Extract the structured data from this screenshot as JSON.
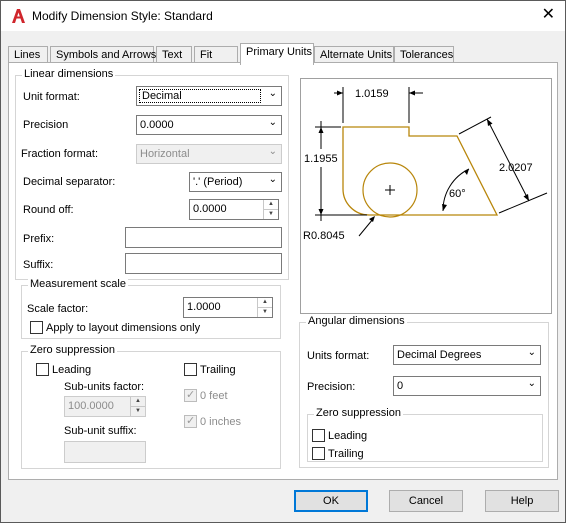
{
  "window": {
    "title": "Modify Dimension Style: Standard",
    "close_glyph": "✕"
  },
  "tabs": [
    {
      "label": "Lines"
    },
    {
      "label": "Symbols and Arrows"
    },
    {
      "label": "Text"
    },
    {
      "label": "Fit"
    },
    {
      "label": "Primary Units"
    },
    {
      "label": "Alternate Units"
    },
    {
      "label": "Tolerances"
    }
  ],
  "active_tab": "Primary Units",
  "linear": {
    "title": "Linear dimensions",
    "unit_format_label": "Unit format:",
    "unit_format_value": "Decimal",
    "precision_label": "Precision",
    "precision_value": "0.0000",
    "fraction_format_label": "Fraction format:",
    "fraction_format_value": "Horizontal",
    "decimal_separator_label": "Decimal separator:",
    "decimal_separator_value": "'.' (Period)",
    "round_off_label": "Round off:",
    "round_off_value": "0.0000",
    "prefix_label": "Prefix:",
    "prefix_value": "",
    "suffix_label": "Suffix:",
    "suffix_value": ""
  },
  "measurement": {
    "title": "Measurement scale",
    "scale_factor_label": "Scale factor:",
    "scale_factor_value": "1.0000",
    "apply_layout_label": "Apply to layout dimensions only",
    "apply_layout_checked": false
  },
  "zero_suppression": {
    "title": "Zero suppression",
    "leading_label": "Leading",
    "leading_checked": false,
    "trailing_label": "Trailing",
    "trailing_checked": false,
    "sub_units_factor_label": "Sub-units factor:",
    "sub_units_factor_value": "100.0000",
    "sub_unit_suffix_label": "Sub-unit suffix:",
    "sub_unit_suffix_value": "",
    "zero_feet_label": "0 feet",
    "zero_feet_checked": true,
    "zero_inches_label": "0 inches",
    "zero_inches_checked": true
  },
  "angular": {
    "title": "Angular dimensions",
    "units_format_label": "Units format:",
    "units_format_value": "Decimal Degrees",
    "precision_label": "Precision:",
    "precision_value": "0",
    "zero_title": "Zero suppression",
    "leading_label": "Leading",
    "leading_checked": false,
    "trailing_label": "Trailing",
    "trailing_checked": false
  },
  "preview": {
    "dim_top": "1.0159",
    "dim_left": "1.1955",
    "dim_right": "2.0207",
    "dim_angle": "60°",
    "dim_radius": "R0.8045",
    "outline_color": "#b8860b"
  },
  "buttons": {
    "ok": "OK",
    "cancel": "Cancel",
    "help": "Help"
  },
  "colors": {
    "accent": "#0078d7",
    "autocad_red": "#d0262c"
  }
}
